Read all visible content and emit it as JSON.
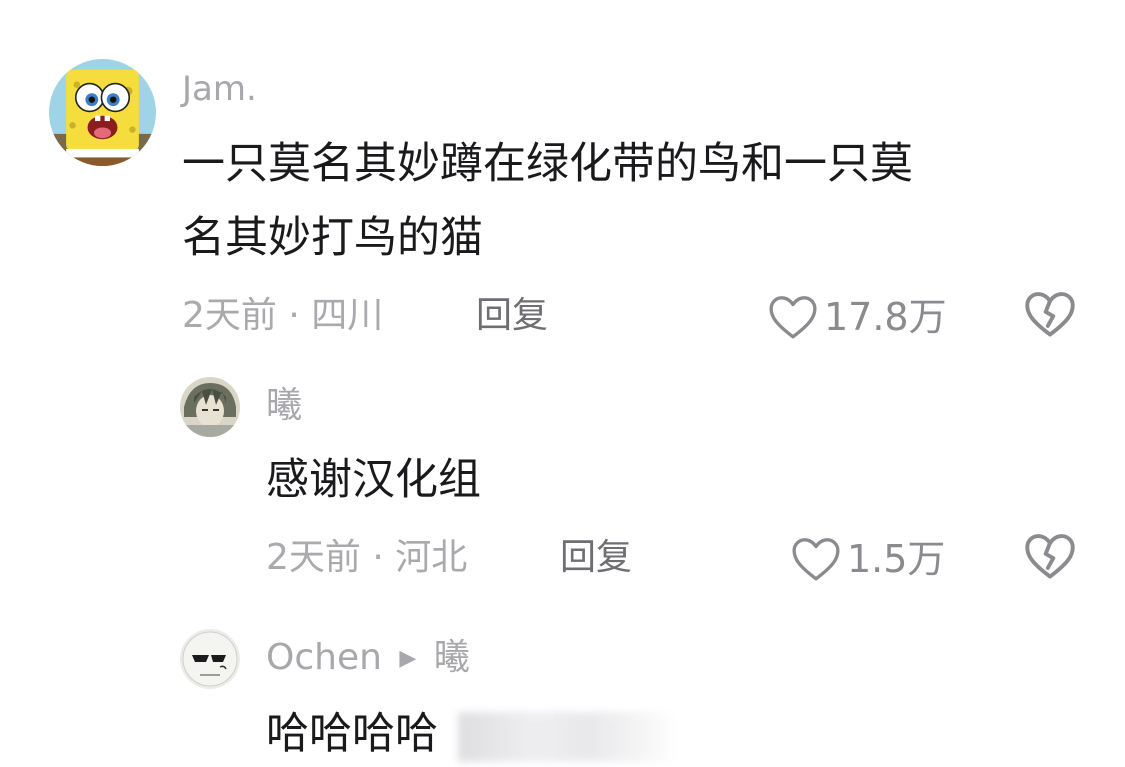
{
  "colors": {
    "background": "#ffffff",
    "username": "#a7a7ac",
    "text": "#1a1a1d",
    "meta": "#a9a9ae",
    "action": "#6e6e73",
    "icon": "#8a8a8f"
  },
  "comments": [
    {
      "username": "Jam.",
      "avatar_icon": "spongebob-avatar",
      "text_line1": "一只莫名其妙蹲在绿化带的鸟和一只莫",
      "text_line2": "名其妙打鸟的猫",
      "time": "2天前",
      "separator": "·",
      "location": "四川",
      "reply_label": "回复",
      "likes": "17.8万",
      "like_icon": "heart-outline-icon",
      "dislike_icon": "broken-heart-icon"
    },
    {
      "username": "曦",
      "avatar_icon": "anime-character-avatar",
      "text": "感谢汉化组",
      "time": "2天前",
      "separator": "·",
      "location": "河北",
      "reply_label": "回复",
      "likes": "1.5万",
      "like_icon": "heart-outline-icon",
      "dislike_icon": "broken-heart-icon"
    },
    {
      "username": "Ochen",
      "reply_arrow": "▶",
      "reply_to": "曦",
      "avatar_icon": "sunglasses-doodle-avatar",
      "text": "哈哈哈哈"
    }
  ]
}
